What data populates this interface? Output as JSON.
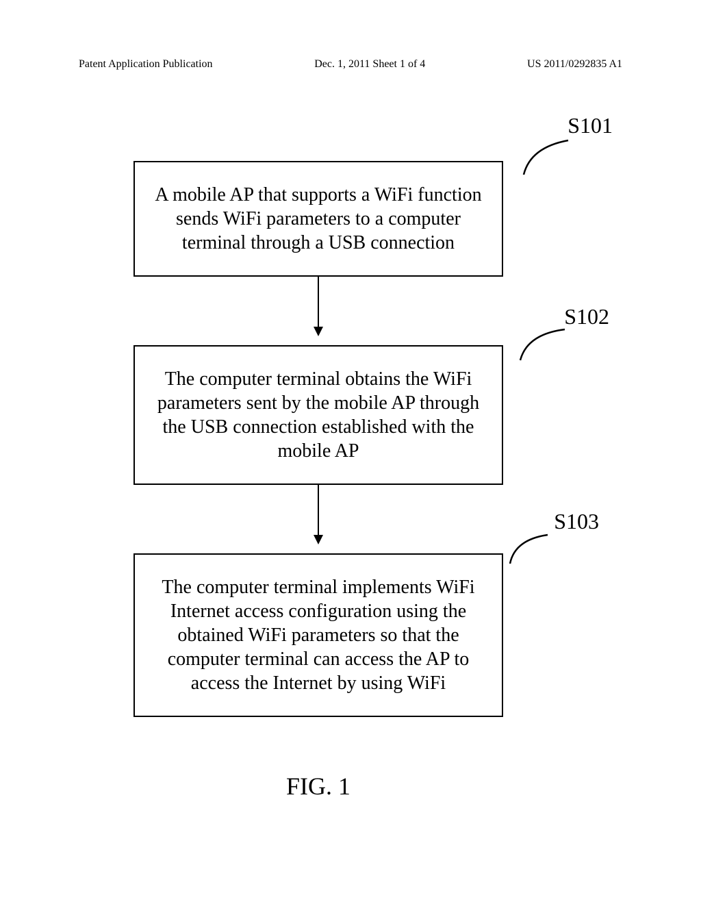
{
  "header": {
    "left": "Patent Application Publication",
    "center": "Dec. 1, 2011  Sheet 1 of 4",
    "right": "US 2011/0292835 A1"
  },
  "steps": [
    {
      "label": "S101",
      "text": "A mobile AP that supports a WiFi function sends WiFi parameters to a computer terminal through a USB connection"
    },
    {
      "label": "S102",
      "text": "The computer terminal obtains the WiFi parameters sent by the mobile AP through the USB connection established with the mobile AP"
    },
    {
      "label": "S103",
      "text": "The computer terminal implements WiFi Internet access configuration using the obtained WiFi parameters so that the computer terminal can access the AP to access the Internet by using WiFi"
    }
  ],
  "figure_caption": "FIG. 1",
  "chart_data": {
    "type": "flowchart",
    "direction": "vertical",
    "nodes": [
      {
        "id": "S101",
        "text": "A mobile AP that supports a WiFi function sends WiFi parameters to a computer terminal through a USB connection"
      },
      {
        "id": "S102",
        "text": "The computer terminal obtains the WiFi parameters sent by the mobile AP through the USB connection established with the mobile AP"
      },
      {
        "id": "S103",
        "text": "The computer terminal implements WiFi Internet access configuration using the obtained WiFi parameters so that the computer terminal can access the AP to access the Internet by using WiFi"
      }
    ],
    "edges": [
      {
        "from": "S101",
        "to": "S102"
      },
      {
        "from": "S102",
        "to": "S103"
      }
    ],
    "title": "FIG. 1"
  }
}
